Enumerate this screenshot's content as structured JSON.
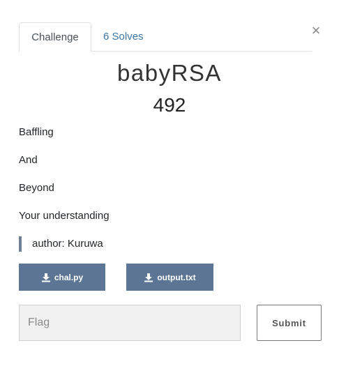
{
  "tabs": [
    {
      "label": "Challenge",
      "active": true
    },
    {
      "label": "6 Solves",
      "active": false
    }
  ],
  "close_icon": "close-icon",
  "challenge": {
    "name": "babyRSA",
    "points": "492",
    "description_lines": [
      "Baffling",
      "And",
      "Beyond",
      "Your understanding"
    ],
    "author": "author: Kuruwa"
  },
  "files": [
    {
      "label": "chal.py",
      "icon": "download-icon"
    },
    {
      "label": "output.txt",
      "icon": "download-icon"
    }
  ],
  "flag_form": {
    "placeholder": "Flag",
    "value": "",
    "submit_label": "Submit"
  },
  "colors": {
    "tab_link": "#3d74a3",
    "file_button": "#5d7594",
    "quote_bar": "#6c7f93"
  }
}
